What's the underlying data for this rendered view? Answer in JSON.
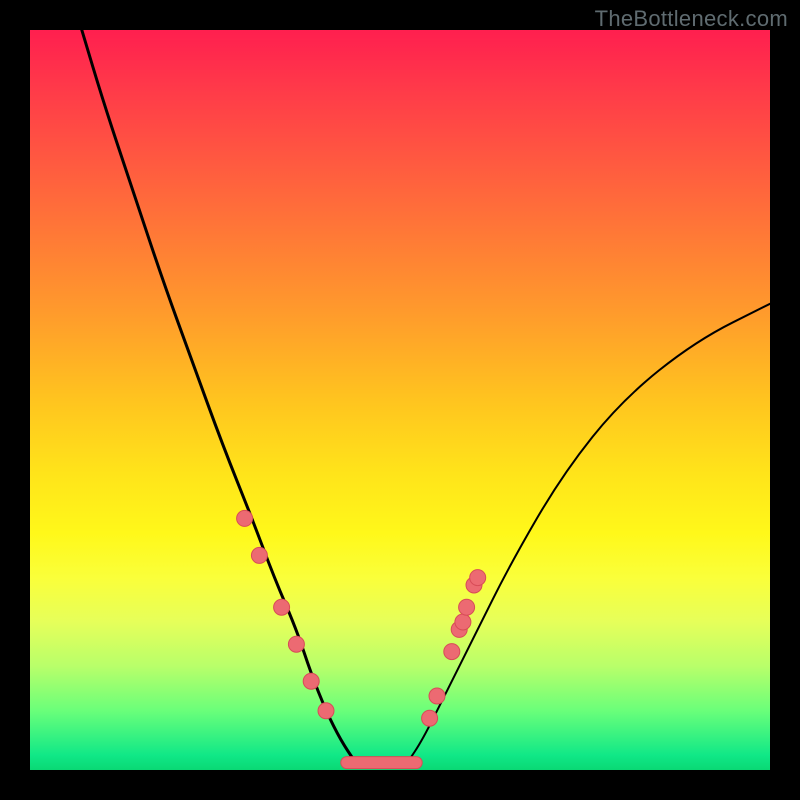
{
  "watermark": "TheBottleneck.com",
  "chart_data": {
    "type": "line",
    "title": "",
    "xlabel": "",
    "ylabel": "",
    "xlim": [
      0,
      100
    ],
    "ylim": [
      0,
      100
    ],
    "grid": false,
    "legend": false,
    "series": [
      {
        "name": "left-branch",
        "x": [
          7,
          10,
          14,
          18,
          22,
          26,
          30,
          33,
          36,
          38,
          40,
          42,
          44
        ],
        "y": [
          100,
          90,
          78,
          66,
          55,
          44,
          34,
          26,
          19,
          13,
          8,
          4,
          1
        ]
      },
      {
        "name": "right-branch",
        "x": [
          51,
          53,
          56,
          60,
          65,
          72,
          80,
          90,
          100
        ],
        "y": [
          1,
          4,
          10,
          18,
          28,
          40,
          50,
          58,
          63
        ]
      },
      {
        "name": "valley-floor",
        "x": [
          44,
          46,
          48,
          50,
          51
        ],
        "y": [
          1,
          0.5,
          0.5,
          0.5,
          1
        ]
      }
    ],
    "highlight_points": {
      "name": "sample-dots",
      "x": [
        29,
        31,
        34,
        36,
        38,
        40,
        54,
        55,
        57,
        58,
        58.5,
        59,
        60,
        60.5
      ],
      "y": [
        34,
        29,
        22,
        17,
        12,
        8,
        7,
        10,
        16,
        19,
        20,
        22,
        25,
        26
      ]
    },
    "valley_strip": {
      "x_start": 42,
      "x_end": 53,
      "y": 1
    },
    "colors": {
      "curve": "#000000",
      "dots": "#ec6a72",
      "gradient_top": "#ff1f4f",
      "gradient_bottom": "#0ad874"
    }
  }
}
